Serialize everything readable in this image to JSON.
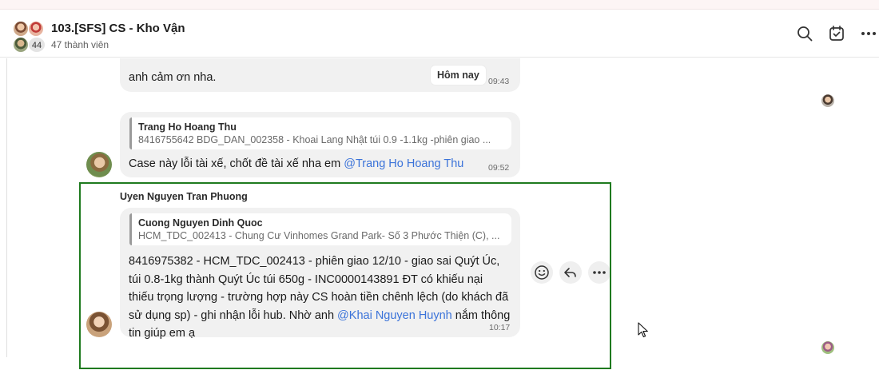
{
  "header": {
    "title": "103.[SFS] CS - Kho Vận",
    "subtitle": "47 thành viên",
    "member_count_badge": "44",
    "icons": [
      "search-icon",
      "task-check-icon",
      "more-icon"
    ]
  },
  "day_separator": "Hôm nay",
  "messages": [
    {
      "text": "anh cảm ơn nha.",
      "time": "09:43"
    },
    {
      "quote": {
        "author": "Trang Ho Hoang Thu",
        "text": "8416755642 BDG_DAN_002358 - Khoai Lang Nhật túi 0.9 -1.1kg -phiên giao ..."
      },
      "text": "Case này lỗi tài xế, chốt đề tài xế nha em ",
      "mention": "@Trang Ho Hoang Thu",
      "time": "09:52"
    },
    {
      "sender": "Uyen Nguyen Tran Phuong",
      "quote": {
        "author": "Cuong Nguyen Dinh Quoc",
        "text": "HCM_TDC_002413 - Chung Cư Vinhomes Grand Park- Số 3 Phước Thiện (C), ..."
      },
      "text_before": "8416975382 - HCM_TDC_002413 - phiên giao 12/10 - giao sai Quýt Úc, túi 0.8-1kg thành Quýt Úc túi 650g - INC0000143891 ĐT có khiếu nại thiếu trọng lượng - trường hợp này CS hoàn tiền chênh lệch (do khách đã sử dụng sp) - ghi nhận lỗi hub. Nhờ anh ",
      "mention": "@Khai Nguyen Huynh",
      "text_after": " nắm thông tin giúp em ạ",
      "time": "10:17"
    }
  ],
  "message_actions": [
    "emoji-react-icon",
    "reply-icon",
    "more-icon"
  ]
}
